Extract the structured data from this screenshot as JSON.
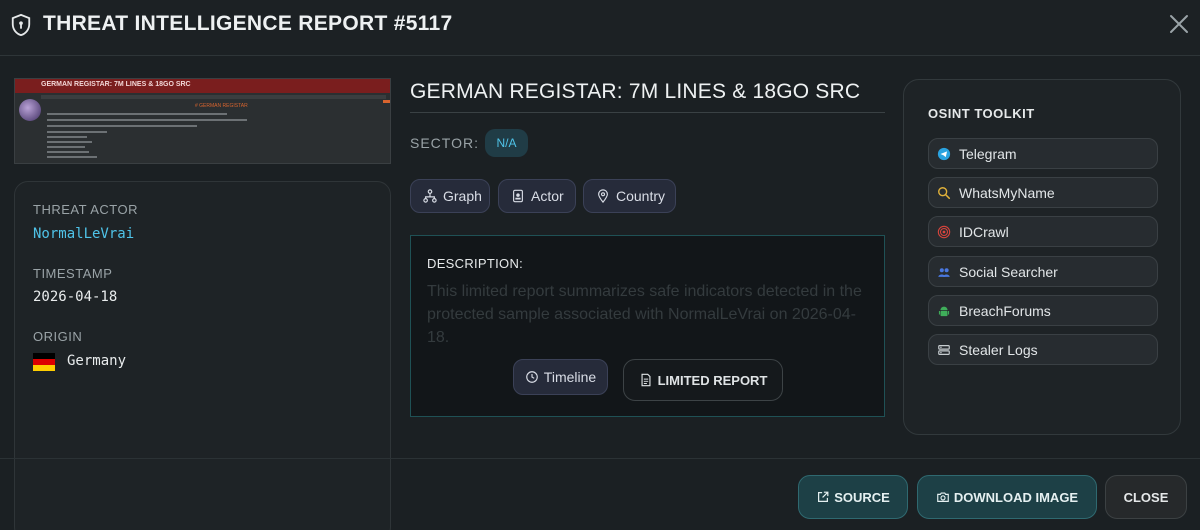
{
  "header": {
    "title": "THREAT INTELLIGENCE REPORT #5117",
    "icons": {
      "logo": "shield-icon",
      "close": "close-icon"
    }
  },
  "thumbnail": {
    "banner_text": "GERMAN REGISTAR: 7M LINES & 18GO SRC",
    "heading_text": "# GERMAN REGISTAR"
  },
  "meta": {
    "threat_actor_label": "THREAT ACTOR",
    "threat_actor": "NormalLeVrai",
    "timestamp_label": "TIMESTAMP",
    "timestamp": "2026-04-18",
    "origin_label": "ORIGIN",
    "origin": "Germany"
  },
  "report": {
    "title": "GERMAN REGISTAR: 7M LINES & 18GO SRC",
    "sector_label": "SECTOR:",
    "sector": "N/A",
    "chips": [
      {
        "label": "Graph",
        "icon": "graph-icon"
      },
      {
        "label": "Actor",
        "icon": "id-badge-icon"
      },
      {
        "label": "Country",
        "icon": "location-pin-icon"
      }
    ],
    "description_label": "DESCRIPTION:",
    "description": "This limited report summarizes safe indicators detected in the protected sample associated with NormalLeVrai on 2026-04-18.",
    "timeline_label": "Timeline",
    "limited_label": "LIMITED REPORT"
  },
  "osint": {
    "title": "OSINT TOOLKIT",
    "tools": [
      {
        "label": "Telegram",
        "icon": "telegram-icon",
        "color": "#2aa3e0"
      },
      {
        "label": "WhatsMyName",
        "icon": "search-icon",
        "color": "#e0b13a"
      },
      {
        "label": "IDCrawl",
        "icon": "fingerprint-icon",
        "color": "#d9453d"
      },
      {
        "label": "Social Searcher",
        "icon": "users-icon",
        "color": "#4a78e0"
      },
      {
        "label": "BreachForums",
        "icon": "android-icon",
        "color": "#3fae5a"
      },
      {
        "label": "Stealer Logs",
        "icon": "server-icon",
        "color": "#c7cdd0"
      }
    ]
  },
  "footer": {
    "source_label": "SOURCE",
    "download_label": "DOWNLOAD IMAGE",
    "close_label": "CLOSE"
  },
  "colors": {
    "background": "#1b2023",
    "accent_teal": "#4fc3e8",
    "flag_black": "#000000",
    "flag_red": "#dd0000",
    "flag_gold": "#ffce00"
  }
}
